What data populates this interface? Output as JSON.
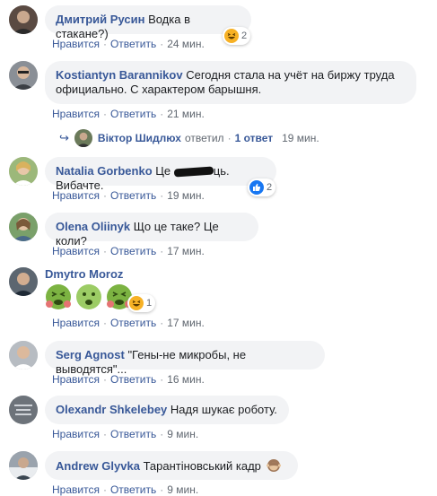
{
  "comments": [
    {
      "author": "Дмитрий Русин",
      "text": "Водка в стакане?)",
      "like": "Нравится",
      "reply": "Ответить",
      "time": "24 мин.",
      "reaction": {
        "icon": "haha-emoji-icon",
        "count": "2"
      }
    },
    {
      "author": "Kostiantyn Barannikov",
      "text": "Сегодня стала на учёт на биржу труда официально. С характером барышня.",
      "like": "Нравится",
      "reply": "Ответить",
      "time": "21 мин."
    },
    {
      "author": "Natalia Gorbenko",
      "text_before": "Це",
      "text_after": "ць. Вибачте.",
      "like": "Нравится",
      "reply": "Ответить",
      "time": "19 мин.",
      "reaction": {
        "icon": "like-icon",
        "count": "2"
      }
    },
    {
      "author": "Olena Oliinyk",
      "text": "Що це таке? Це коли?",
      "like": "Нравится",
      "reply": "Ответить",
      "time": "17 мин."
    },
    {
      "author": "Dmytro Moroz",
      "emojis": [
        "nauseated-face-icon",
        "nauseated-face-icon",
        "nauseated-face-icon"
      ],
      "like": "Нравится",
      "reply": "Ответить",
      "time": "17 мин.",
      "reaction": {
        "icon": "haha-emoji-icon",
        "count": "1"
      }
    },
    {
      "author": "Serg Agnost",
      "text": "\"Гены-не микробы, не выводятся\"...",
      "like": "Нравится",
      "reply": "Ответить",
      "time": "16 мин."
    },
    {
      "author": "Olexandr Shkelebey",
      "text": "Надя шукає роботу.",
      "like": "Нравится",
      "reply": "Ответить",
      "time": "9 мин."
    },
    {
      "author": "Andrew Glyvka",
      "text": "Тарантіновський кадр",
      "text_emoji": "see-no-evil-monkey-icon",
      "like": "Нравится",
      "reply": "Ответить",
      "time": "9 мин."
    }
  ],
  "replies": {
    "name": "Віктор Шидлюх",
    "verb": "ответил",
    "count": "1 ответ",
    "time": "19 мин."
  },
  "colors": {
    "author": "#385898",
    "bubble": "#f2f3f5",
    "meta": "#606770",
    "like_blue": "#1877f2",
    "haha_yellow": "#f7b125",
    "nauseated_green": "#7cb342"
  }
}
